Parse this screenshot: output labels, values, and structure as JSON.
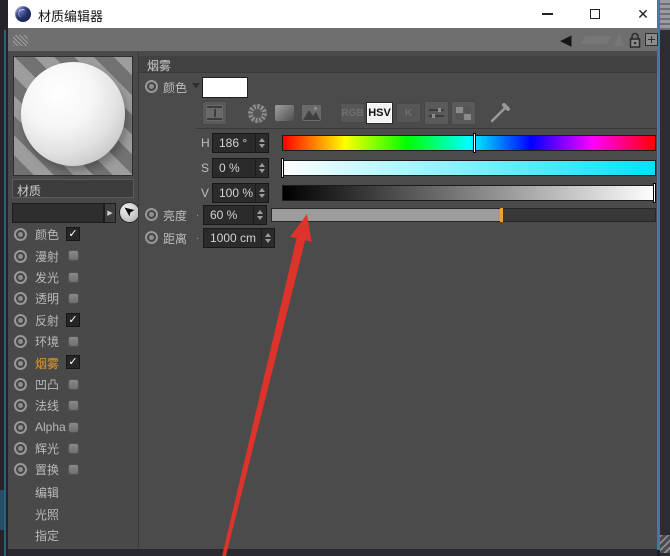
{
  "window": {
    "title": "材质编辑器",
    "close_glyph": "✕"
  },
  "toolbar": {
    "back_glyph": "◀"
  },
  "icons": {
    "check": "✓",
    "dropdown": "▼",
    "combo_arrow": "▶"
  },
  "sidebar": {
    "material_name": "材质",
    "channels": [
      {
        "label": "颜色",
        "checked": true,
        "selected": false
      },
      {
        "label": "漫射",
        "checked": false,
        "selected": false
      },
      {
        "label": "发光",
        "checked": false,
        "selected": false
      },
      {
        "label": "透明",
        "checked": false,
        "selected": false
      },
      {
        "label": "反射",
        "checked": true,
        "selected": false
      },
      {
        "label": "环境",
        "checked": false,
        "selected": false
      },
      {
        "label": "烟雾",
        "checked": true,
        "selected": true
      },
      {
        "label": "凹凸",
        "checked": false,
        "selected": false
      },
      {
        "label": "法线",
        "checked": false,
        "selected": false
      },
      {
        "label": "Alpha",
        "checked": false,
        "selected": false
      },
      {
        "label": "辉光",
        "checked": false,
        "selected": false
      },
      {
        "label": "置换",
        "checked": false,
        "selected": false
      }
    ],
    "sections": [
      "编辑",
      "光照",
      "指定"
    ]
  },
  "main": {
    "header": "烟雾",
    "color_label": "颜色",
    "color_value": "#ffffff",
    "color_buttons": [
      "RGB",
      "HSV",
      "K"
    ],
    "color_buttons_active": "HSV",
    "hsv": [
      {
        "label": "H",
        "value": "186 °",
        "percent": 51.7
      },
      {
        "label": "S",
        "value": "0 %",
        "percent": 0
      },
      {
        "label": "V",
        "value": "100 %",
        "percent": 100
      }
    ],
    "brightness": {
      "label": "亮度",
      "dots": ". .",
      "value": "60 %",
      "percent": 60
    },
    "distance": {
      "label": "距离",
      "dots": ". :",
      "value": "1000 cm"
    }
  },
  "colors": {
    "selected_channel": "#e29a2e",
    "slider_handle": "#eda42f",
    "arrow_red": "#e53228",
    "window_border": "#3f7d9e"
  }
}
